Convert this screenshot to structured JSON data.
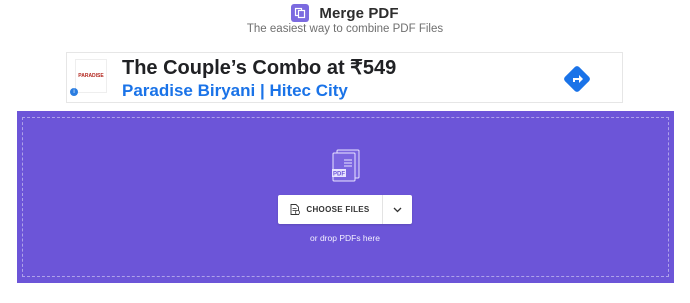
{
  "header": {
    "title": "Merge PDF",
    "subtitle": "The easiest way to combine PDF Files",
    "logo_icon": "merge-pages-icon"
  },
  "ad": {
    "headline": "The Couple’s Combo at ₹549",
    "subline": "Paradise Biryani | Hitec City",
    "brand_logo_text": "PARADISE",
    "cta_icon": "directions-arrow-icon",
    "info_icon": "ad-info-icon"
  },
  "dropzone": {
    "file_icon": "pdf-file-icon",
    "file_icon_label": "PDF",
    "choose_button_label": "CHOOSE FILES",
    "choose_button_icon": "file-add-icon",
    "dropdown_icon": "chevron-down-icon",
    "hint": "or drop PDFs here"
  },
  "colors": {
    "accent": "#6c55d8",
    "logo": "#7b6ae0",
    "link_blue": "#1a73e8",
    "cta_blue": "#1a73e8"
  }
}
